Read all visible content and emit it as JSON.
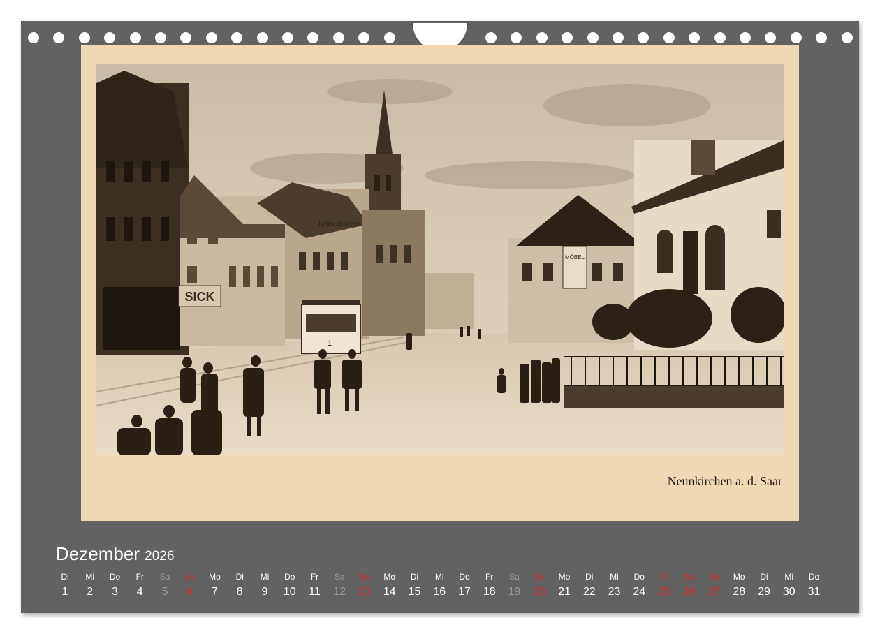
{
  "photo": {
    "caption": "Neunkirchen a. d. Saar",
    "signs": {
      "sick": "SICK",
      "kaffee": "Kaffee Höhchen",
      "moebel": "MÖBEL",
      "tram_number": "1"
    }
  },
  "calendar": {
    "month": "Dezember",
    "year": "2026",
    "days": [
      {
        "dn": "Di",
        "d": "1",
        "kind": "weekday"
      },
      {
        "dn": "Mi",
        "d": "2",
        "kind": "weekday"
      },
      {
        "dn": "Do",
        "d": "3",
        "kind": "weekday"
      },
      {
        "dn": "Fr",
        "d": "4",
        "kind": "weekday"
      },
      {
        "dn": "Sa",
        "d": "5",
        "kind": "saturday"
      },
      {
        "dn": "So",
        "d": "6",
        "kind": "red"
      },
      {
        "dn": "Mo",
        "d": "7",
        "kind": "weekday"
      },
      {
        "dn": "Di",
        "d": "8",
        "kind": "weekday"
      },
      {
        "dn": "Mi",
        "d": "9",
        "kind": "weekday"
      },
      {
        "dn": "Do",
        "d": "10",
        "kind": "weekday"
      },
      {
        "dn": "Fr",
        "d": "11",
        "kind": "weekday"
      },
      {
        "dn": "Sa",
        "d": "12",
        "kind": "saturday"
      },
      {
        "dn": "So",
        "d": "13",
        "kind": "red"
      },
      {
        "dn": "Mo",
        "d": "14",
        "kind": "weekday"
      },
      {
        "dn": "Di",
        "d": "15",
        "kind": "weekday"
      },
      {
        "dn": "Mi",
        "d": "16",
        "kind": "weekday"
      },
      {
        "dn": "Do",
        "d": "17",
        "kind": "weekday"
      },
      {
        "dn": "Fr",
        "d": "18",
        "kind": "weekday"
      },
      {
        "dn": "Sa",
        "d": "19",
        "kind": "saturday"
      },
      {
        "dn": "So",
        "d": "20",
        "kind": "red"
      },
      {
        "dn": "Mo",
        "d": "21",
        "kind": "weekday"
      },
      {
        "dn": "Di",
        "d": "22",
        "kind": "weekday"
      },
      {
        "dn": "Mi",
        "d": "23",
        "kind": "weekday"
      },
      {
        "dn": "Do",
        "d": "24",
        "kind": "weekday"
      },
      {
        "dn": "Fr",
        "d": "25",
        "kind": "red"
      },
      {
        "dn": "Sa",
        "d": "26",
        "kind": "red"
      },
      {
        "dn": "So",
        "d": "27",
        "kind": "red"
      },
      {
        "dn": "Mo",
        "d": "28",
        "kind": "weekday"
      },
      {
        "dn": "Di",
        "d": "29",
        "kind": "weekday"
      },
      {
        "dn": "Mi",
        "d": "30",
        "kind": "weekday"
      },
      {
        "dn": "Do",
        "d": "31",
        "kind": "weekday"
      }
    ]
  },
  "colors": {
    "frame": "#626262",
    "mount": "#f1d8b4",
    "sepia_dark": "#2a1f14",
    "sepia_light": "#e3d5bd",
    "holiday_red": "#d42a2a",
    "saturday_grey": "#9b9b9b"
  }
}
